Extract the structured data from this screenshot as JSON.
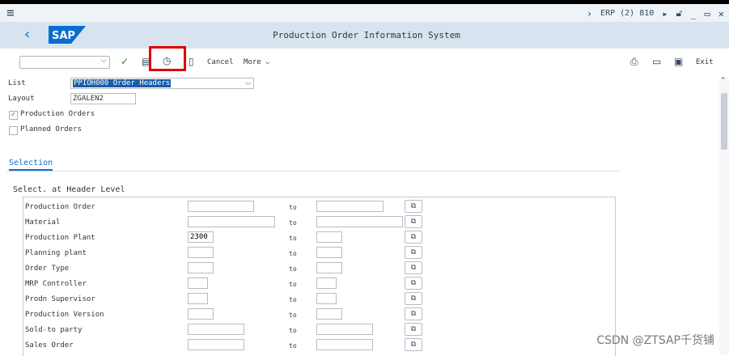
{
  "menubar": {
    "system_label": "ERP (2) 810"
  },
  "titlebar": {
    "logo_text": "SAP",
    "title": "Production Order Information System"
  },
  "toolbar": {
    "command_value": "",
    "cancel_label": "Cancel",
    "more_label": "More",
    "exit_label": "Exit"
  },
  "header": {
    "list_label": "List",
    "list_value": "PPIOH000 Order Headers",
    "layout_label": "Layout",
    "layout_value": "ZGALEN2",
    "production_orders_label": "Production Orders",
    "production_orders_checked": true,
    "planned_orders_label": "Planned Orders",
    "planned_orders_checked": false
  },
  "tabs": {
    "selection_label": "Selection"
  },
  "selection": {
    "group_title": "Select. at Header Level",
    "to_label": "to",
    "rows": [
      {
        "label": "Production Order",
        "from": "",
        "to": ""
      },
      {
        "label": "Material",
        "from": "",
        "to": ""
      },
      {
        "label": "Production Plant",
        "from": "2300",
        "to": ""
      },
      {
        "label": "Planning plant",
        "from": "",
        "to": ""
      },
      {
        "label": "Order Type",
        "from": "",
        "to": ""
      },
      {
        "label": "MRP Controller",
        "from": "",
        "to": ""
      },
      {
        "label": "Prodn Supervisor",
        "from": "",
        "to": ""
      },
      {
        "label": "Production Version",
        "from": "",
        "to": ""
      },
      {
        "label": "Sold-to party",
        "from": "",
        "to": ""
      },
      {
        "label": "Sales Order",
        "from": "",
        "to": ""
      }
    ]
  },
  "watermark": "CSDN @ZTSAP千货铺"
}
